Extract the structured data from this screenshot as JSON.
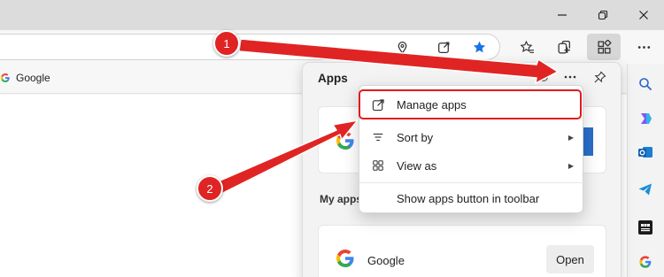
{
  "window": {
    "controls": [
      {
        "name": "minimize-icon"
      },
      {
        "name": "restore-icon"
      },
      {
        "name": "close-icon"
      }
    ]
  },
  "toolbar": {
    "icons": [
      "location-icon",
      "share-icon",
      "star-filled-icon",
      "favorites-icon",
      "collections-icon",
      "apps-icon",
      "more-icon"
    ],
    "accent_color": "#1a73e8"
  },
  "favorites_bar": {
    "items": [
      {
        "label": "Google",
        "icon": "google-icon"
      }
    ]
  },
  "apps_panel": {
    "title": "Apps",
    "section_label": "My apps",
    "installed_app": {
      "name": "Google",
      "open_label": "Open"
    }
  },
  "context_menu": {
    "items": [
      {
        "label": "Manage apps",
        "icon": "open-external-icon",
        "has_submenu": false
      },
      {
        "label": "Sort by",
        "icon": "sort-icon",
        "has_submenu": true
      },
      {
        "label": "View as",
        "icon": "grid-icon",
        "has_submenu": true
      },
      {
        "label": "Show apps button in toolbar",
        "icon": "",
        "has_submenu": false
      }
    ]
  },
  "sidebar": {
    "icons": [
      "search-icon",
      "copilot-icon",
      "outlook-icon",
      "telegram-icon",
      "bbc-icon",
      "google-icon"
    ]
  },
  "annotations": {
    "steps": [
      "1",
      "2"
    ],
    "color": "#e02424"
  }
}
